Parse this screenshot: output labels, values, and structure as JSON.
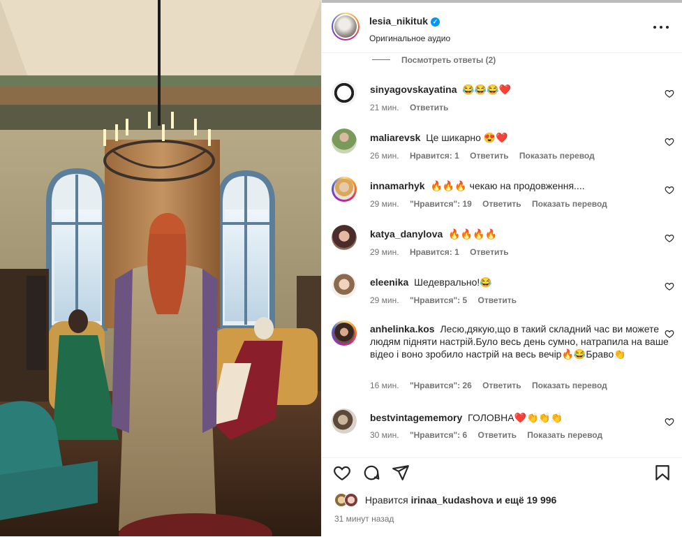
{
  "post": {
    "username": "lesia_nikituk",
    "verified_icon": "verified-badge-icon",
    "audio": "Оригинальное аудио",
    "more_icon": "more-options-icon"
  },
  "replies_toggle": "Посмотреть ответы (2)",
  "comments": [
    {
      "user": "sinyagovskayatina",
      "text": "😂😂😂❤️",
      "time": "21 мин.",
      "likes": "",
      "reply": "Ответить",
      "translate": ""
    },
    {
      "user": "maliarevsk",
      "text": "Це шикарно 😍❤️",
      "time": "26 мин.",
      "likes": "Нравится: 1",
      "reply": "Ответить",
      "translate": "Показать перевод"
    },
    {
      "user": "innamarhyk",
      "text": "🔥🔥🔥 чекаю на продовження....",
      "time": "29 мин.",
      "likes": "\"Нравится\": 19",
      "reply": "Ответить",
      "translate": "Показать перевод"
    },
    {
      "user": "katya_danylova",
      "text": "🔥🔥🔥🔥",
      "time": "29 мин.",
      "likes": "Нравится: 1",
      "reply": "Ответить",
      "translate": ""
    },
    {
      "user": "eleenika",
      "text": "Шедеврально!😂",
      "time": "29 мин.",
      "likes": "\"Нравится\": 5",
      "reply": "Ответить",
      "translate": ""
    },
    {
      "user": "anhelinka.kos",
      "text": "Лесю,дякую,що в такий складний час ви можете людям підняти настрій.Було весь день сумно, натрапила на ваше відео і воно зробило настрій на весь вечір🔥😂Браво👏",
      "time": "16 мин.",
      "likes": "\"Нравится\": 26",
      "reply": "Ответить",
      "translate": "Показать перевод"
    },
    {
      "user": "bestvintagememory",
      "text": "ГОЛОВНА❤️👏👏👏",
      "time": "30 мин.",
      "likes": "\"Нравится\": 6",
      "reply": "Ответить",
      "translate": "Показать перевод"
    }
  ],
  "actions": {
    "like_icon": "heart-icon",
    "comment_icon": "comment-icon",
    "share_icon": "share-icon",
    "save_icon": "bookmark-icon"
  },
  "likes": {
    "prefix": "Нравится",
    "user": "irinaa_kudashova",
    "suffix": "и ещё 19 996"
  },
  "time_ago": "31 минут назад",
  "colors": {
    "link": "#0095f6",
    "muted": "#737373",
    "text": "#262626"
  }
}
